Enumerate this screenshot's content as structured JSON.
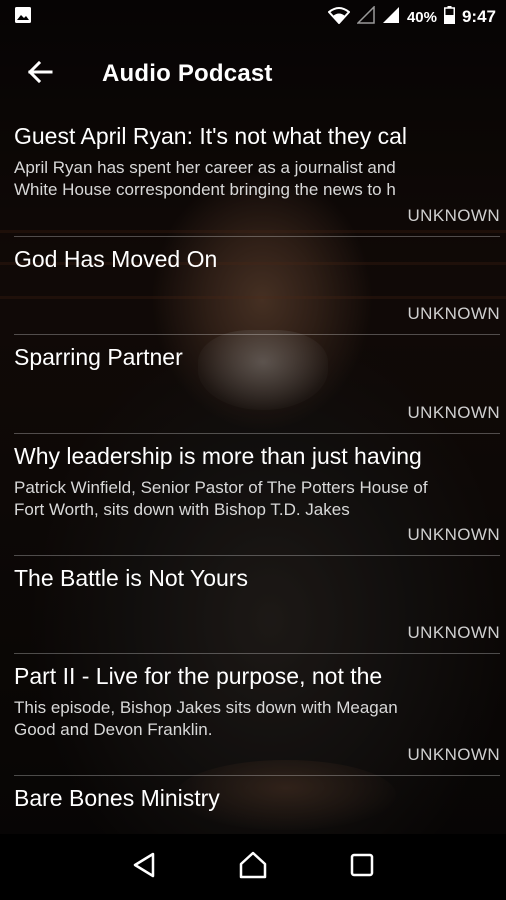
{
  "status_bar": {
    "battery": "40%",
    "time": "9:47",
    "icons": [
      "image-notification-icon",
      "wifi-icon",
      "signal-empty-icon",
      "signal-full-icon",
      "battery-icon"
    ]
  },
  "app_bar": {
    "title": "Audio Podcast",
    "back_icon": "arrow-back-icon"
  },
  "episodes": [
    {
      "title": "Guest April Ryan: It's not what they cal",
      "description": "April Ryan has spent her career as a journalist and\nWhite House correspondent bringing the news to h",
      "status": "UNKNOWN"
    },
    {
      "title": "God Has Moved On",
      "description": "",
      "status": "UNKNOWN"
    },
    {
      "title": "Sparring Partner",
      "description": "",
      "status": "UNKNOWN"
    },
    {
      "title": "Why leadership is more than just having",
      "description": "Patrick Winfield, Senior Pastor of The Potters House of\nFort Worth, sits down with Bishop T.D. Jakes",
      "status": "UNKNOWN"
    },
    {
      "title": "The Battle is Not Yours",
      "description": "",
      "status": "UNKNOWN"
    },
    {
      "title": "Part II - Live for the purpose, not the",
      "description": "This episode, Bishop Jakes sits down with Meagan\nGood and Devon Franklin.",
      "status": "UNKNOWN"
    },
    {
      "title": "Bare Bones Ministry",
      "description": "",
      "status": ""
    }
  ],
  "nav_bar": {
    "icons": [
      "back-triangle-icon",
      "home-icon",
      "recents-square-icon"
    ]
  },
  "colors": {
    "background": "#000000",
    "text": "#ffffff",
    "secondary_text": "#d8d8d8"
  }
}
